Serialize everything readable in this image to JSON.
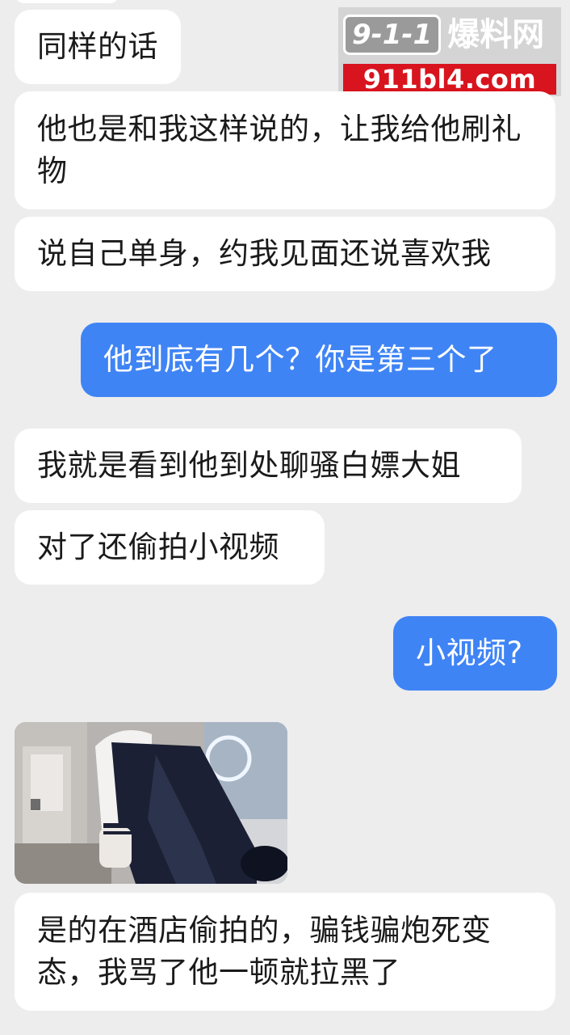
{
  "watermark": {
    "logo_number": "9-1-1",
    "logo_text": "爆料网",
    "domain": "911bl4.com"
  },
  "messages": [
    {
      "side": "received",
      "text": "同样的话"
    },
    {
      "side": "received",
      "text": "他也是和我这样说的，让我给他刷礼物"
    },
    {
      "side": "received",
      "text": "说自己单身，约我见面还说喜欢我"
    },
    {
      "side": "sent",
      "text": "他到底有几个？你是第三个了"
    },
    {
      "side": "received",
      "text": "我就是看到他到处聊骚白嫖大姐"
    },
    {
      "side": "received",
      "text": "对了还偷拍小视频"
    },
    {
      "side": "sent",
      "text": "小视频?"
    },
    {
      "side": "received",
      "type": "image",
      "alt_icon": "video-thumbnail"
    },
    {
      "side": "received",
      "text": "是的在酒店偷拍的，骗钱骗炮死变态，我骂了他一顿就拉黑了"
    }
  ],
  "colors": {
    "background": "#ededed",
    "received_bubble": "#ffffff",
    "sent_bubble": "#3f84f5",
    "watermark_red": "#d8141e"
  }
}
